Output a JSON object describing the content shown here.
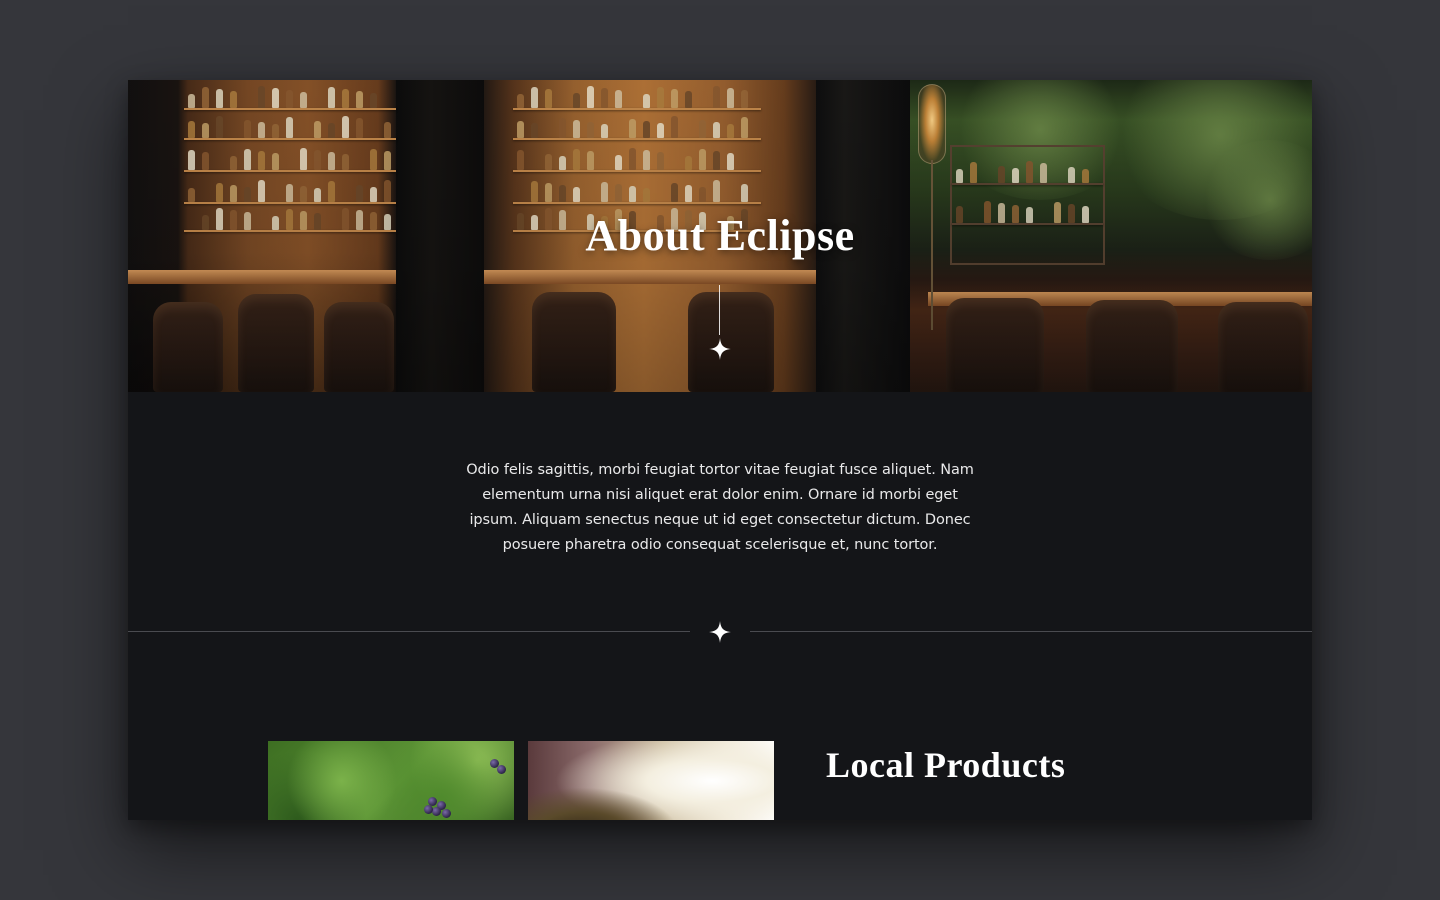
{
  "hero": {
    "title": "About Eclipse",
    "image": "bar-interior-photo",
    "ornament": "sparkle-icon"
  },
  "about": {
    "paragraph": "Odio felis sagittis, morbi feugiat tortor vitae feugiat fusce aliquet. Nam elementum urna nisi aliquet erat dolor enim. Ornare id morbi eget ipsum. Aliquam senectus neque ut id eget consectetur dictum. Donec posuere pharetra odio consequat scelerisque et, nunc tortor."
  },
  "divider": {
    "ornament": "sparkle-icon"
  },
  "local_products": {
    "title": "Local Products",
    "images": [
      "grapevine-photo",
      "wine-bottle-photo"
    ]
  },
  "colors": {
    "page_background": "#35363b",
    "content_background": "#141518",
    "text": "#ffffff",
    "divider_line": "#4a4b50"
  }
}
